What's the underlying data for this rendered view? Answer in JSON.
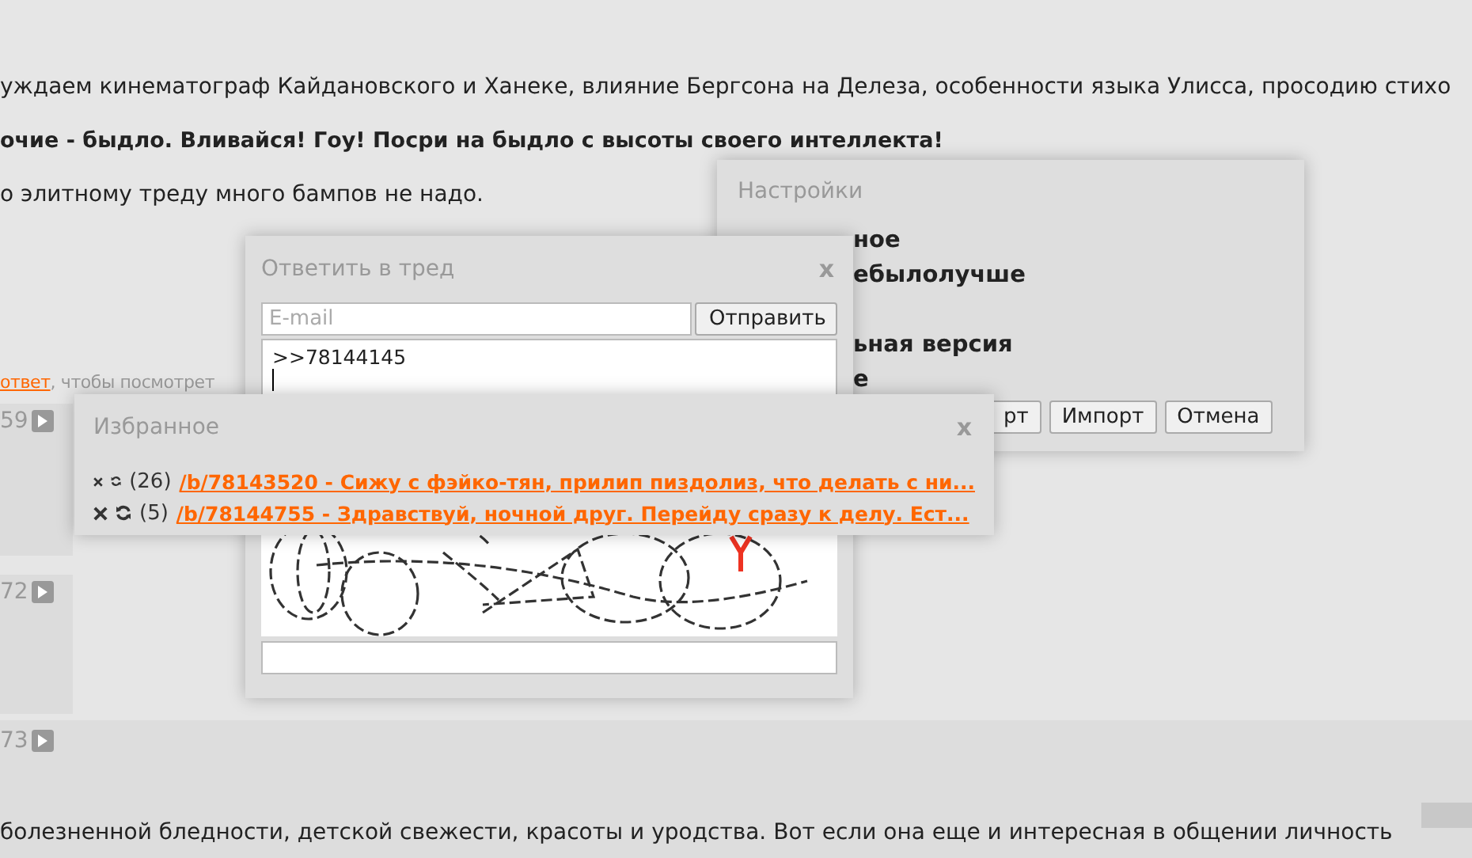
{
  "page": {
    "lines": [
      {
        "text": "уждаем кинематограф Кайдановского и Ханеке, влияние Бергсона на Делеза, особенности языка Улисса, просодию стихо",
        "bold": false
      },
      {
        "text": "очие - быдло. Вливайся! Гоу! Посри на быдло с высоты своего интеллекта!",
        "bold": true
      },
      {
        "text": "о элитному треду много бампов не надо.",
        "bold": false
      }
    ],
    "hint": {
      "link": "ответ",
      "text": ", чтобы посмотрет"
    },
    "posts": [
      {
        "number": "59"
      },
      {
        "number": "72"
      },
      {
        "number": "73"
      }
    ],
    "bottom_text": "болезненной бледности, детской свежести, красоты и уродства. Вот если она еще и интересная в общении личность"
  },
  "settings": {
    "title": "Настройки",
    "items": [
      "ное",
      "ебылолучше",
      "ьная версия",
      "е"
    ],
    "buttons": [
      "рт",
      "Импорт",
      "Отмена"
    ]
  },
  "reply": {
    "title": "Ответить в тред",
    "close": "x",
    "email": {
      "placeholder": "E-mail"
    },
    "send": "Отправить",
    "message": ">>78144145"
  },
  "favorites": {
    "title": "Избранное",
    "close": "x",
    "items": [
      {
        "count": "(26)",
        "link": "/b/78143520 - Сижу с фэйко-тян, прилип пиздолиз, что делать с ни..."
      },
      {
        "count": "(5)",
        "link": "/b/78144755 - Здравствуй, ночной друг. Перейду сразу к делу. Ест..."
      }
    ]
  }
}
